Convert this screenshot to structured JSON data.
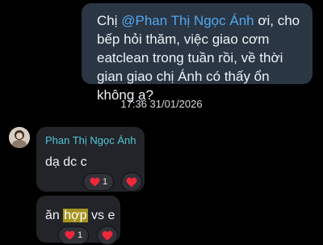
{
  "outgoing_message": {
    "text_before": "Chị ",
    "mention": "@Phan Thị Ngọc Ánh",
    "text_after": " ơi, cho bếp hỏi thăm, việc giao cơm eatclean trong tuần rồi, về thời gian giao chị Ánh có thấy ổn không ạ?"
  },
  "timestamp": "17:36 31/01/2026",
  "incoming_messages": [
    {
      "sender": "Phan Thị Ngọc Ánh",
      "text": "dạ dc c",
      "reaction": {
        "icon": "heart-icon",
        "count": "1"
      }
    },
    {
      "text_before": "ăn ",
      "highlight": "hợp",
      "text_after": " vs e",
      "reaction": {
        "icon": "heart-icon",
        "count": "1"
      }
    }
  ],
  "colors": {
    "background": "#000000",
    "outgoing_bubble": "#2a3644",
    "incoming_bubble": "#222429",
    "mention": "#52a8f0",
    "sender_name": "#4fc7d6",
    "highlight": "#a6931f",
    "heart": "#f0283c"
  }
}
